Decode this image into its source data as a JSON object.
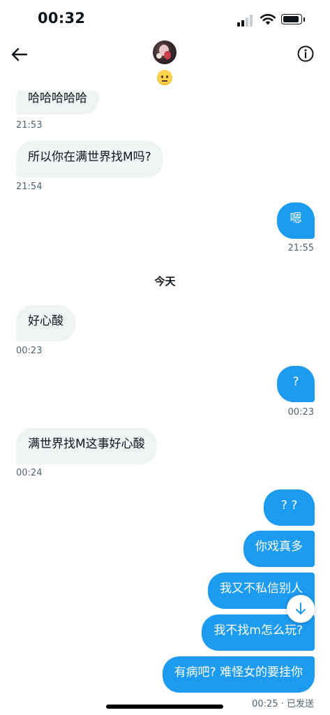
{
  "status_bar": {
    "time": "00:32"
  },
  "header": {
    "avatar_alt": "",
    "status_emoji": "😶"
  },
  "messages": [
    {
      "text": "哈哈哈哈哈",
      "time": "21:53"
    },
    {
      "text": "所以你在满世界找M吗?",
      "time": "21:54"
    },
    {
      "text": "嗯",
      "time": "21:55"
    },
    {
      "text": "好心酸",
      "time": "00:23"
    },
    {
      "text": "?",
      "time": "00:23"
    },
    {
      "text": "满世界找M这事好心酸",
      "time": "00:24"
    },
    {
      "text": "? ?"
    },
    {
      "text": "你戏真多"
    },
    {
      "text": "我又不私信别人"
    },
    {
      "text": "我不找m怎么玩?"
    },
    {
      "text": "有病吧? 难怪女的要挂你",
      "time": "00:25 · 已发送"
    }
  ],
  "day_separator": "今天",
  "colors": {
    "accent": "#1d9bf0",
    "incoming_bg": "#eff3f4",
    "muted": "#536471"
  },
  "icons": {
    "back": "arrow-left-icon",
    "info": "info-icon",
    "scroll": "arrow-down-icon",
    "wifi": "wifi-icon",
    "signal": "cellular-signal-icon",
    "battery": "battery-icon"
  }
}
